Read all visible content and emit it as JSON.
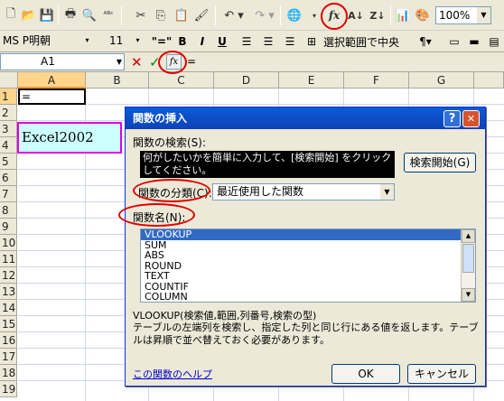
{
  "toolbar": {
    "zoom": "100%",
    "font_name": "MS P明朝",
    "font_size": "11",
    "bold": "B",
    "italic": "I",
    "underline": "U",
    "merge_center": "選択範囲で中央",
    "fx": "fx",
    "icons": [
      "new-icon",
      "open-icon",
      "save-icon",
      "print-icon",
      "preview-icon",
      "spell-icon",
      "cut-icon",
      "copy-icon",
      "paste-icon",
      "format-painter-icon",
      "undo-icon",
      "redo-icon",
      "hyperlink-icon",
      "insert-function-icon",
      "sort-asc-icon",
      "sort-desc-icon",
      "chart-icon",
      "drawing-icon"
    ]
  },
  "formula_bar": {
    "name_box": "A1",
    "cancel": "✕",
    "enter": "✓",
    "fx": "fx",
    "content": "="
  },
  "sheet": {
    "columns": [
      "A",
      "B",
      "C",
      "D",
      "E",
      "F",
      "G"
    ],
    "rows": [
      "1",
      "2",
      "3",
      "4",
      "5",
      "6",
      "7",
      "8",
      "9",
      "10",
      "11",
      "12",
      "13",
      "14",
      "15",
      "16",
      "17",
      "18",
      "19"
    ],
    "a1_value": "=",
    "annotation": "Excel2002"
  },
  "dialog": {
    "title": "関数の挿入",
    "help_btn": "?",
    "close_btn": "✕",
    "search_label": "関数の検索(S):",
    "search_text": "何がしたいかを簡単に入力して、[検索開始] をクリックしてください。",
    "search_button": "検索開始(G)",
    "category_label": "関数の分類(C):",
    "category_value": "最近使用した関数",
    "func_name_label": "関数名(N):",
    "functions": [
      "VLOOKUP",
      "SUM",
      "ABS",
      "ROUND",
      "TEXT",
      "COUNTIF",
      "COLUMN"
    ],
    "signature": "VLOOKUP(検索値,範囲,列番号,検索の型)",
    "description": "テーブルの左端列を検索し、指定した列と同じ行にある値を返します。テーブルは昇順で並べ替えておく必要があります。",
    "help_link": "この関数のヘルプ",
    "ok": "OK",
    "cancel": "キャンセル"
  }
}
